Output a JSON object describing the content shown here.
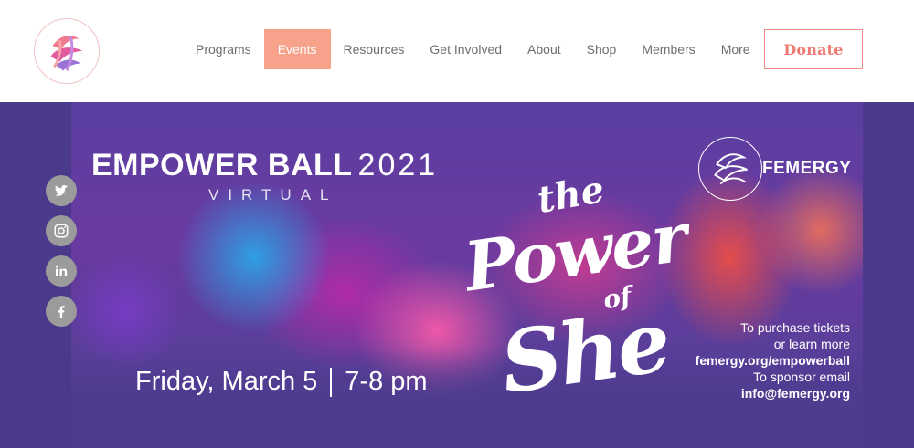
{
  "nav": {
    "items": [
      {
        "label": "Programs",
        "active": false
      },
      {
        "label": "Events",
        "active": true
      },
      {
        "label": "Resources",
        "active": false
      },
      {
        "label": "Get Involved",
        "active": false
      },
      {
        "label": "About",
        "active": false
      },
      {
        "label": "Shop",
        "active": false
      },
      {
        "label": "Members",
        "active": false
      },
      {
        "label": "More",
        "active": false
      }
    ],
    "donate_label": "Donate"
  },
  "banner": {
    "title": "EMPOWER BALL",
    "year": "2021",
    "subtitle": "VIRTUAL",
    "brand": "FEMERGY",
    "slogan": {
      "the": "the",
      "power": "Power",
      "of": "of",
      "she": "She"
    },
    "date": "Friday, March 5",
    "time": "7-8 pm",
    "info": {
      "line1": "To purchase tickets",
      "line2": "or learn more",
      "url": "femergy.org/empowerball",
      "line4": "To sponsor email",
      "email": "info@femergy.org"
    }
  },
  "social": [
    "twitter-icon",
    "instagram-icon",
    "linkedin-icon",
    "facebook-icon"
  ],
  "colors": {
    "accent": "#f7a38c",
    "donate": "#ee7b74",
    "hero_bg": "#4b3a8c",
    "social_icon_bg": "#9b9b9b"
  }
}
